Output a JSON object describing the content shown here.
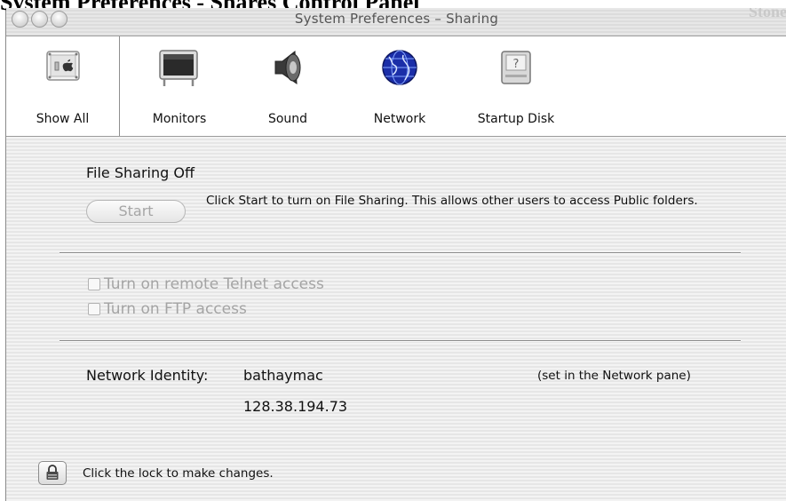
{
  "page_caption": "System Preferences - Shares Control Panel",
  "window": {
    "title": "System Preferences – Sharing",
    "title_fragment_right": "Stone"
  },
  "toolbar": {
    "items": [
      {
        "label": "Show All",
        "icon": "show-all-icon"
      },
      {
        "label": "Monitors",
        "icon": "monitor-icon"
      },
      {
        "label": "Sound",
        "icon": "speaker-icon"
      },
      {
        "label": "Network",
        "icon": "globe-icon"
      },
      {
        "label": "Startup Disk",
        "icon": "disk-icon"
      }
    ]
  },
  "file_sharing": {
    "status": "File Sharing Off",
    "start_label": "Start",
    "description": "Click Start to turn on File Sharing. This allows other users to access Public folders."
  },
  "options": {
    "telnet_label": "Turn on remote Telnet access",
    "ftp_label": "Turn on FTP access"
  },
  "network_identity": {
    "label": "Network Identity:",
    "hostname": "bathaymac",
    "ip": "128.38.194.73",
    "note": "(set in the Network pane)"
  },
  "lock": {
    "message": "Click the lock to make changes."
  }
}
